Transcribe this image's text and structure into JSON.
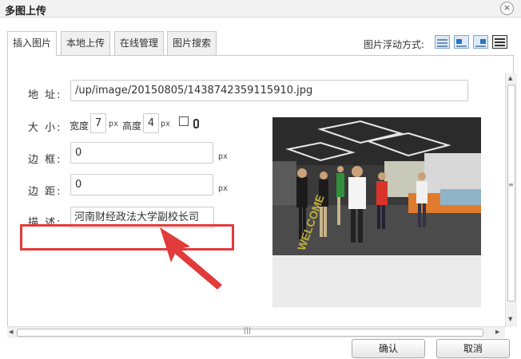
{
  "window": {
    "title": "多图上传",
    "close_glyph": "×"
  },
  "tabs": [
    {
      "label": "插入图片",
      "active": true
    },
    {
      "label": "本地上传",
      "active": false
    },
    {
      "label": "在线管理",
      "active": false
    },
    {
      "label": "图片搜索",
      "active": false
    }
  ],
  "float": {
    "label": "图片浮动方式:",
    "options": [
      "none",
      "left",
      "right",
      "center"
    ],
    "selected": "center"
  },
  "form": {
    "address_label": "地  址:",
    "address_value": "/up/image/20150805/1438742359115910.jpg",
    "size_label": "大  小:",
    "width_label": "宽度",
    "width_value": "7",
    "height_label": "高度",
    "height_value": "4",
    "unit": "px",
    "border_label": "边  框:",
    "border_value": "0",
    "margin_label": "边  距:",
    "margin_value": "0",
    "desc_label": "描  述:",
    "desc_value": "河南财经政法大学副校长司"
  },
  "colors": {
    "highlight": "#e23b3b",
    "arrow": "#e23b3b"
  },
  "buttons": {
    "confirm": "确认",
    "cancel": "取消"
  }
}
